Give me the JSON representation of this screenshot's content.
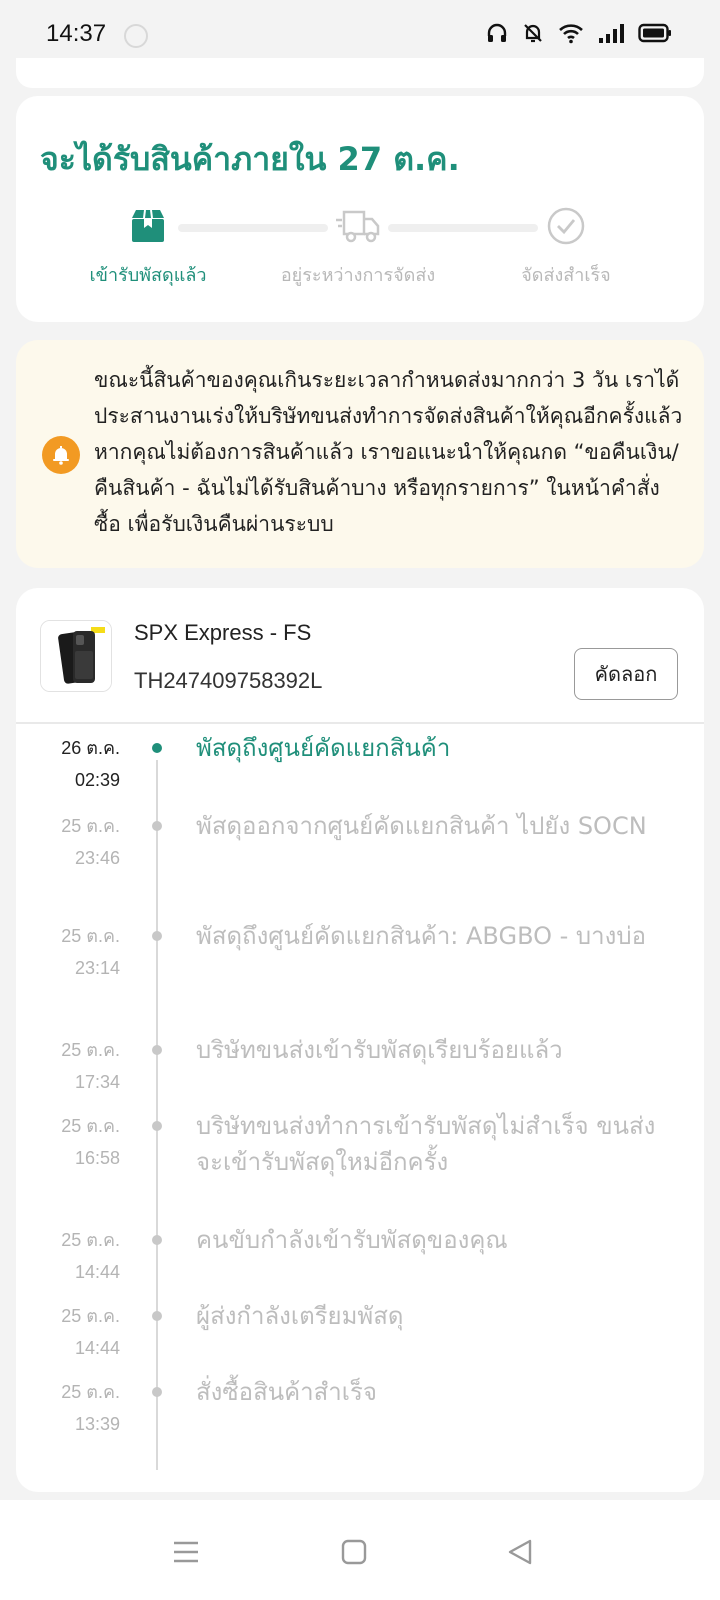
{
  "status_bar": {
    "time": "14:37",
    "icons": [
      "headset-icon",
      "bell-off-icon",
      "wifi-icon",
      "signal-icon",
      "battery-icon"
    ]
  },
  "eta": {
    "title": "จะได้รับสินค้าภายใน 27 ต.ค."
  },
  "steps": [
    {
      "label": "เข้ารับพัสดุแล้ว",
      "icon": "box-icon",
      "active": true
    },
    {
      "label": "อยู่ระหว่างการจัดส่ง",
      "icon": "truck-icon",
      "active": false
    },
    {
      "label": "จัดส่งสำเร็จ",
      "icon": "check-circle-icon",
      "active": false
    }
  ],
  "notice": {
    "icon": "bell-icon",
    "text": "ขณะนี้สินค้าของคุณเกินระยะเวลากำหนดส่งมากกว่า 3 วัน เราได้ประสานงานเร่งให้บริษัทขนส่งทำการจัดส่งสินค้าให้คุณอีกครั้งแล้ว หากคุณไม่ต้องการสินค้าแล้ว เราขอแนะนำให้คุณกด “ขอคืนเงิน/ คืนสินค้า - ฉันไม่ได้รับสินค้าบาง หรือทุกรายการ” ในหน้าคำสั่งซื้อ เพื่อรับเงินคืนผ่านระบบ"
  },
  "shipment": {
    "carrier": "SPX Express - FS",
    "tracking_number": "TH247409758392L",
    "copy_label": "คัดลอก"
  },
  "timeline": [
    {
      "date": "26 ต.ค.",
      "time": "02:39",
      "text": "พัสดุถึงศูนย์คัดแยกสินค้า",
      "active": true
    },
    {
      "date": "25 ต.ค.",
      "time": "23:46",
      "text": "พัสดุออกจากศูนย์คัดแยกสินค้า ไปยัง SOCN",
      "active": false
    },
    {
      "date": "25 ต.ค.",
      "time": "23:14",
      "text": "พัสดุถึงศูนย์คัดแยกสินค้า: ABGBO - บางบ่อ",
      "active": false
    },
    {
      "date": "25 ต.ค.",
      "time": "17:34",
      "text": "บริษัทขนส่งเข้ารับพัสดุเรียบร้อยแล้ว",
      "active": false
    },
    {
      "date": "25 ต.ค.",
      "time": "16:58",
      "text": "บริษัทขนส่งทำการเข้ารับพัสดุไม่สำเร็จ ขนส่งจะเข้ารับพัสดุใหม่อีกครั้ง",
      "active": false
    },
    {
      "date": "25 ต.ค.",
      "time": "14:44",
      "text": "คนขับกำลังเข้ารับพัสดุของคุณ",
      "active": false
    },
    {
      "date": "25 ต.ค.",
      "time": "14:44",
      "text": " ผู้ส่งกำลังเตรียมพัสดุ",
      "active": false
    },
    {
      "date": "25 ต.ค.",
      "time": "13:39",
      "text": "สั่งซื้อสินค้าสำเร็จ",
      "active": false
    }
  ],
  "nav": {
    "buttons": [
      "menu-icon",
      "home-square-icon",
      "back-triangle-icon"
    ]
  },
  "colors": {
    "accent": "#1f8f7a",
    "notice_bg": "#fdf9ec",
    "bell": "#f29a23"
  }
}
